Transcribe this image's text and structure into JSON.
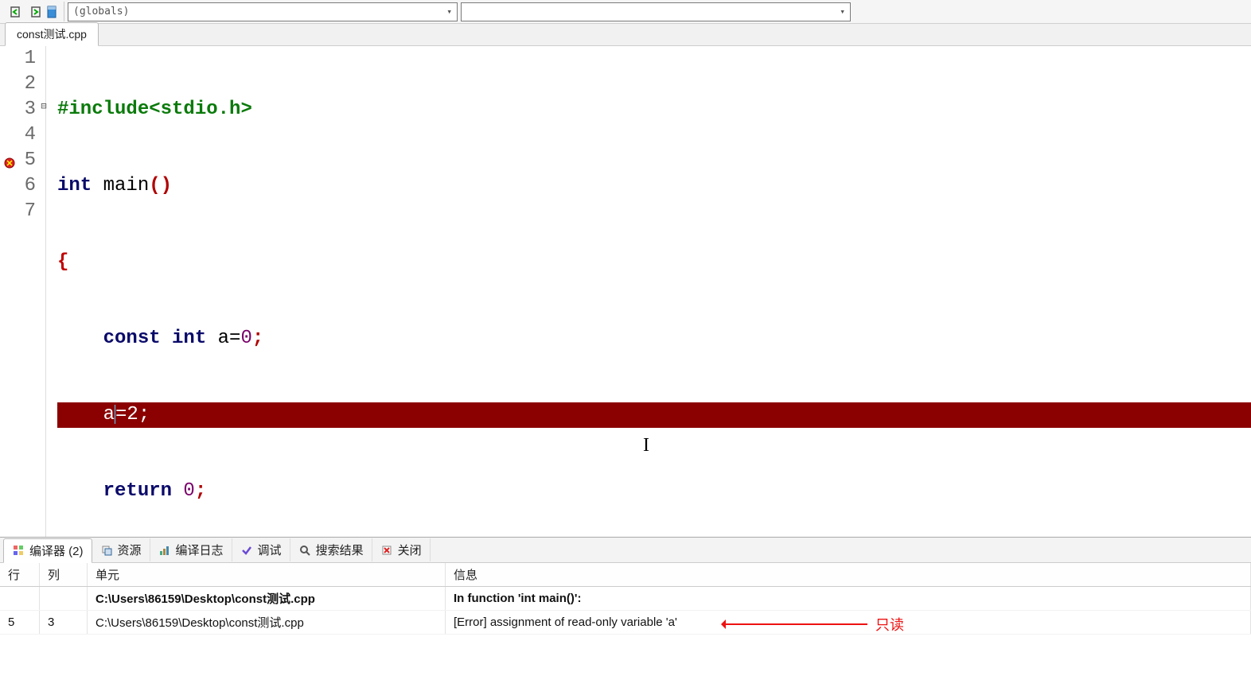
{
  "toolbar": {
    "scope_combo": "(globals)",
    "symbol_combo": ""
  },
  "tabs": {
    "file_tab": "const测试.cpp"
  },
  "editor": {
    "lines": [
      "1",
      "2",
      "3",
      "4",
      "5",
      "6",
      "7"
    ],
    "code": {
      "l1_include": "#include",
      "l1_header": "<stdio.h>",
      "l2_int": "int",
      "l2_main": " main",
      "l2_par": "()",
      "l3_brace": "{",
      "l4_const": "const",
      "l4_int": " int",
      "l4_assign": " a=",
      "l4_zero": "0",
      "l4_semi": ";",
      "l5_err": "a=2;",
      "l5_pre": "a",
      "l5_post": "=2;",
      "l6_return": "return",
      "l6_zero": " 0",
      "l6_semi": ";",
      "l7_brace": "}"
    }
  },
  "bottom": {
    "tabs": {
      "compiler": "编译器 (2)",
      "resources": "资源",
      "compile_log": "编译日志",
      "debug": "调试",
      "search_results": "搜索结果",
      "close": "关闭"
    },
    "columns": {
      "line": "行",
      "col": "列",
      "unit": "单元",
      "info": "信息"
    },
    "rows": {
      "r1_unit": "C:\\Users\\86159\\Desktop\\const测试.cpp",
      "r1_info": "In function 'int main()':",
      "r2_line": "5",
      "r2_col": "3",
      "r2_unit": "C:\\Users\\86159\\Desktop\\const测试.cpp",
      "r2_info": "[Error] assignment of read-only variable 'a'"
    },
    "annotation": "只读"
  }
}
